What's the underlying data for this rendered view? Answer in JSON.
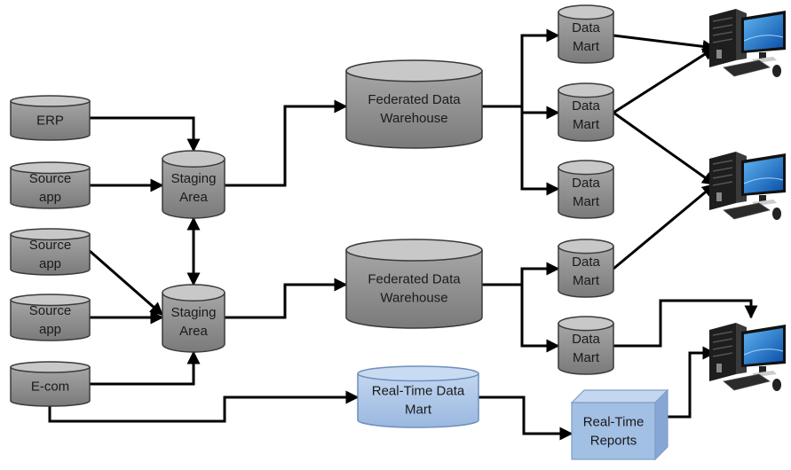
{
  "diagram": {
    "title": "",
    "colors": {
      "cylinder_gray": "#8c8c8c",
      "cylinder_gray_top": "#c8c8c8",
      "cylinder_blue": "#a9c4e6",
      "cylinder_blue_top": "#c9dbf2",
      "box_blue": "#a2bfe4",
      "edge": "#000000",
      "text": "#1a1a1a"
    },
    "nodes": [
      {
        "id": "erp",
        "kind": "cylinder",
        "style": "gray",
        "lines": [
          "ERP"
        ]
      },
      {
        "id": "src1",
        "kind": "cylinder",
        "style": "gray",
        "lines": [
          "Source",
          "app"
        ]
      },
      {
        "id": "src2",
        "kind": "cylinder",
        "style": "gray",
        "lines": [
          "Source",
          "app"
        ]
      },
      {
        "id": "src3",
        "kind": "cylinder",
        "style": "gray",
        "lines": [
          "Source",
          "app"
        ]
      },
      {
        "id": "ecom",
        "kind": "cylinder",
        "style": "gray",
        "lines": [
          "E-com"
        ]
      },
      {
        "id": "stg1",
        "kind": "cylinder",
        "style": "gray",
        "lines": [
          "Staging",
          "Area"
        ]
      },
      {
        "id": "stg2",
        "kind": "cylinder",
        "style": "gray",
        "lines": [
          "Staging",
          "Area"
        ]
      },
      {
        "id": "fdw1",
        "kind": "cylinder",
        "style": "gray",
        "lines": [
          "Federated Data",
          "Warehouse"
        ]
      },
      {
        "id": "fdw2",
        "kind": "cylinder",
        "style": "gray",
        "lines": [
          "Federated Data",
          "Warehouse"
        ]
      },
      {
        "id": "dm1",
        "kind": "cylinder",
        "style": "gray",
        "lines": [
          "Data",
          "Mart"
        ]
      },
      {
        "id": "dm2",
        "kind": "cylinder",
        "style": "gray",
        "lines": [
          "Data",
          "Mart"
        ]
      },
      {
        "id": "dm3",
        "kind": "cylinder",
        "style": "gray",
        "lines": [
          "Data",
          "Mart"
        ]
      },
      {
        "id": "dm4",
        "kind": "cylinder",
        "style": "gray",
        "lines": [
          "Data",
          "Mart"
        ]
      },
      {
        "id": "dm5",
        "kind": "cylinder",
        "style": "gray",
        "lines": [
          "Data",
          "Mart"
        ]
      },
      {
        "id": "rtdm",
        "kind": "cylinder",
        "style": "blue",
        "lines": [
          "Real-Time Data",
          "Mart"
        ]
      },
      {
        "id": "rtr",
        "kind": "box3d",
        "style": "blue",
        "lines": [
          "Real-Time",
          "Reports"
        ]
      },
      {
        "id": "pc1",
        "kind": "computer",
        "icon": "desktop-computer-icon"
      },
      {
        "id": "pc2",
        "kind": "computer",
        "icon": "desktop-computer-icon"
      },
      {
        "id": "pc3",
        "kind": "computer",
        "icon": "desktop-computer-icon"
      }
    ],
    "edges": [
      {
        "from": "erp",
        "to": "stg1"
      },
      {
        "from": "src1",
        "to": "stg1"
      },
      {
        "from": "stg1",
        "to": "stg2",
        "bidirectional": true
      },
      {
        "from": "src2",
        "to": "stg2"
      },
      {
        "from": "src3",
        "to": "stg2"
      },
      {
        "from": "ecom",
        "to": "stg2"
      },
      {
        "from": "ecom",
        "to": "rtdm"
      },
      {
        "from": "stg1",
        "to": "fdw1"
      },
      {
        "from": "stg2",
        "to": "fdw2"
      },
      {
        "from": "fdw1",
        "to": "dm1"
      },
      {
        "from": "fdw1",
        "to": "dm2"
      },
      {
        "from": "fdw1",
        "to": "dm3"
      },
      {
        "from": "fdw2",
        "to": "dm4"
      },
      {
        "from": "fdw2",
        "to": "dm5"
      },
      {
        "from": "dm1",
        "to": "pc1"
      },
      {
        "from": "dm2",
        "to": "pc1"
      },
      {
        "from": "dm2",
        "to": "pc2"
      },
      {
        "from": "dm4",
        "to": "pc2"
      },
      {
        "from": "dm5",
        "to": "pc3"
      },
      {
        "from": "rtdm",
        "to": "rtr"
      },
      {
        "from": "rtr",
        "to": "pc3"
      }
    ]
  }
}
